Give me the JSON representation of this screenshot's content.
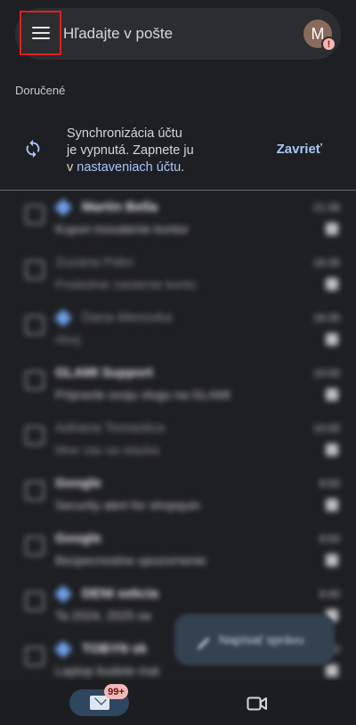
{
  "search": {
    "placeholder": "Hľadajte v pošte"
  },
  "account": {
    "avatar_letter": "M",
    "alert_symbol": "!"
  },
  "mailbox": {
    "label": "Doručené"
  },
  "sync_banner": {
    "line1": "Synchronizácia účtu",
    "line2": "je vypnutá. Zapnete ju",
    "line3_prefix": "v ",
    "link_text": "nastaveniach účtu",
    "line3_suffix": ".",
    "close_label": "Zavrieť"
  },
  "mail_list": [
    {
      "sender": "Martin Bella",
      "subject": "Kupon inovalenie kontor",
      "time": "21:36",
      "starred": true,
      "unread": true
    },
    {
      "sender": "Zuzana Pekn",
      "subject": "Poslednie zaistenie kontu",
      "time": "16:35",
      "starred": false,
      "unread": false
    },
    {
      "sender": "Dana Menovka",
      "subject": "Ahoj",
      "time": "16:35",
      "starred": true,
      "unread": false
    },
    {
      "sender": "GLAMI Support",
      "subject": "Pripravte svoju vlogu na GLAMI",
      "time": "10:00",
      "starred": false,
      "unread": true
    },
    {
      "sender": "Adriana Tomastica",
      "subject": "Mne vas sa otazka",
      "time": "10:00",
      "starred": false,
      "unread": false
    },
    {
      "sender": "Google",
      "subject": "Security alert for shopquin",
      "time": "9:50",
      "starred": false,
      "unread": true
    },
    {
      "sender": "Google",
      "subject": "Bezpecnostne upozornenie",
      "time": "9:50",
      "starred": false,
      "unread": true
    },
    {
      "sender": "DENI sekcia",
      "subject": "Ta 2024, 2025 sa",
      "time": "9:40",
      "starred": true,
      "unread": true
    },
    {
      "sender": "TOBYN sk",
      "subject": "Laptop budete mat",
      "time": "9:30",
      "starred": true,
      "unread": true
    }
  ],
  "compose": {
    "label": "Napísať správu"
  },
  "bottom_nav": {
    "mail_badge": "99+"
  },
  "colors": {
    "accent": "#a8c7fa",
    "badge": "#f2b8b5",
    "highlight_box": "#e0201d"
  }
}
